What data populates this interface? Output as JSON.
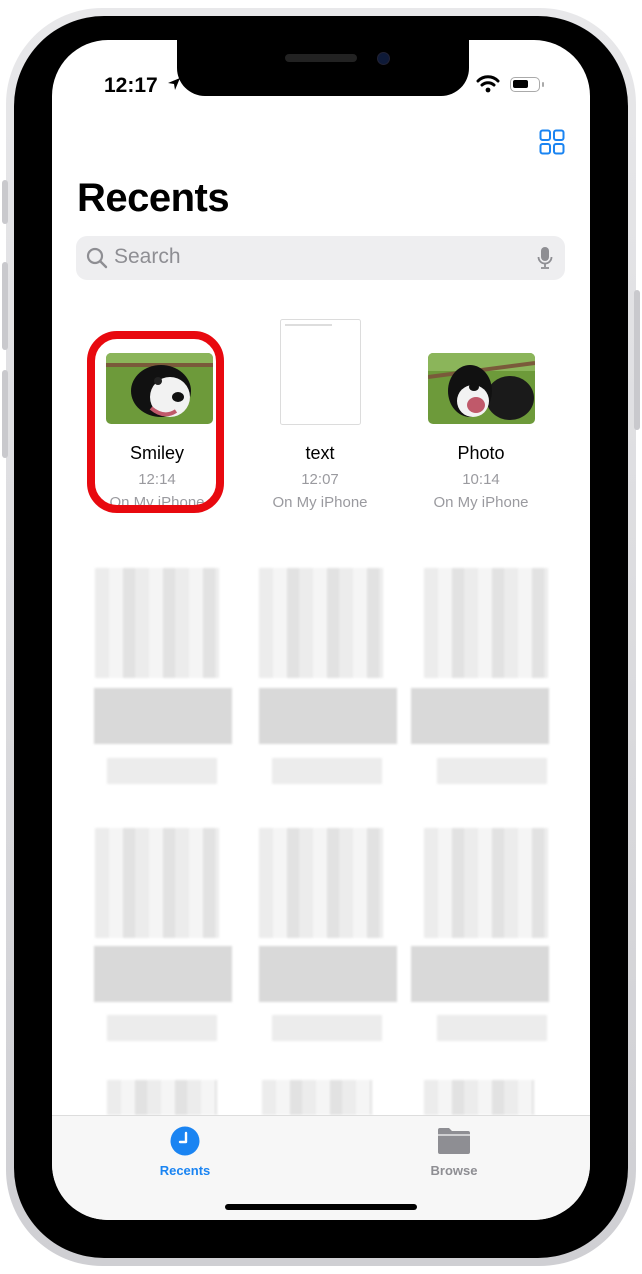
{
  "status_bar": {
    "time": "12:17",
    "icons": [
      "location-arrow-icon",
      "wifi-icon",
      "battery-icon"
    ]
  },
  "header": {
    "title": "Recents",
    "view_toggle_icon": "grid-view-icon"
  },
  "search": {
    "placeholder": "Search",
    "value": "",
    "mic_icon": "microphone-icon"
  },
  "files": [
    {
      "name": "Smiley",
      "time": "12:14",
      "location": "On My iPhone",
      "type": "photo",
      "highlighted": true
    },
    {
      "name": "text",
      "time": "12:07",
      "location": "On My iPhone",
      "type": "document",
      "highlighted": false
    },
    {
      "name": "Photo",
      "time": "10:14",
      "location": "On My iPhone",
      "type": "photo",
      "highlighted": false
    }
  ],
  "blurred_rows": 3,
  "tab_bar": {
    "tabs": [
      {
        "label": "Recents",
        "icon": "clock-icon",
        "active": true
      },
      {
        "label": "Browse",
        "icon": "folder-icon",
        "active": false
      }
    ]
  },
  "colors": {
    "accent": "#1a84f2",
    "highlight": "#e8090f",
    "inactive": "#8e8e93"
  }
}
